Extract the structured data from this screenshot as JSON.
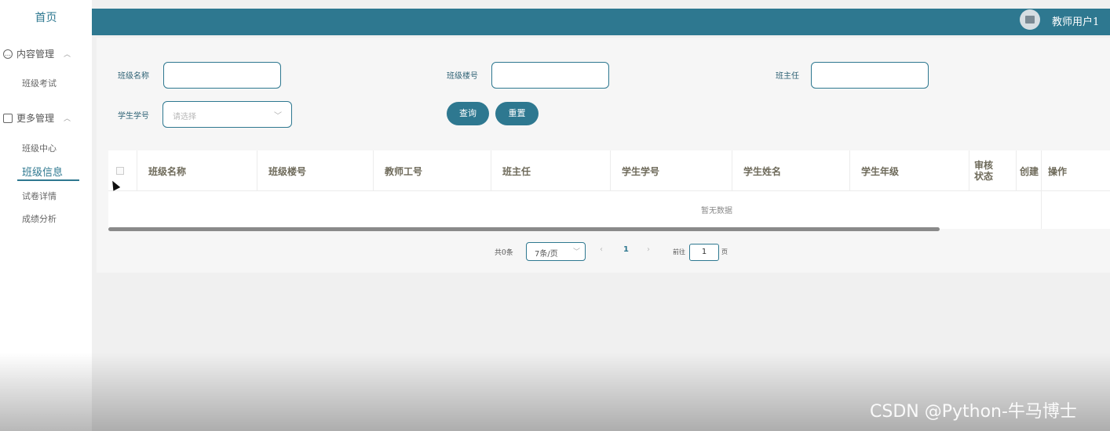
{
  "sidebar": {
    "home": "首页",
    "groups": [
      {
        "label": "内容管理",
        "icon": "chat-icon",
        "items": [
          "班级考试"
        ]
      },
      {
        "label": "更多管理",
        "icon": "copy-icon",
        "items": [
          "班级中心",
          "班级信息",
          "试卷详情",
          "成绩分析"
        ]
      }
    ],
    "active_item": "班级信息"
  },
  "header": {
    "username": "教师用户1",
    "avatar_icon": "image-icon"
  },
  "filters": {
    "class_name_label": "班级名称",
    "class_no_label": "班级楼号",
    "head_teacher_label": "班主任",
    "student_no_label": "学生学号",
    "student_no_placeholder": "请选择",
    "class_name_value": "",
    "class_no_value": "",
    "head_teacher_value": ""
  },
  "buttons": {
    "query": "查询",
    "reset": "重置"
  },
  "table": {
    "columns": [
      "班级名称",
      "班级楼号",
      "教师工号",
      "班主任",
      "学生学号",
      "学生姓名",
      "学生年级",
      "审核状态",
      "创建",
      "操作"
    ],
    "empty_text": "暂无数据"
  },
  "pagination": {
    "total": "共0条",
    "page_size": "7条/页",
    "current_page": "1",
    "goto_label": "前往",
    "goto_value": "1",
    "page_suffix": "页"
  },
  "watermark": "CSDN @Python-牛马博士",
  "colors": {
    "primary": "#2e7890",
    "header_text": "#6e6a5a"
  }
}
